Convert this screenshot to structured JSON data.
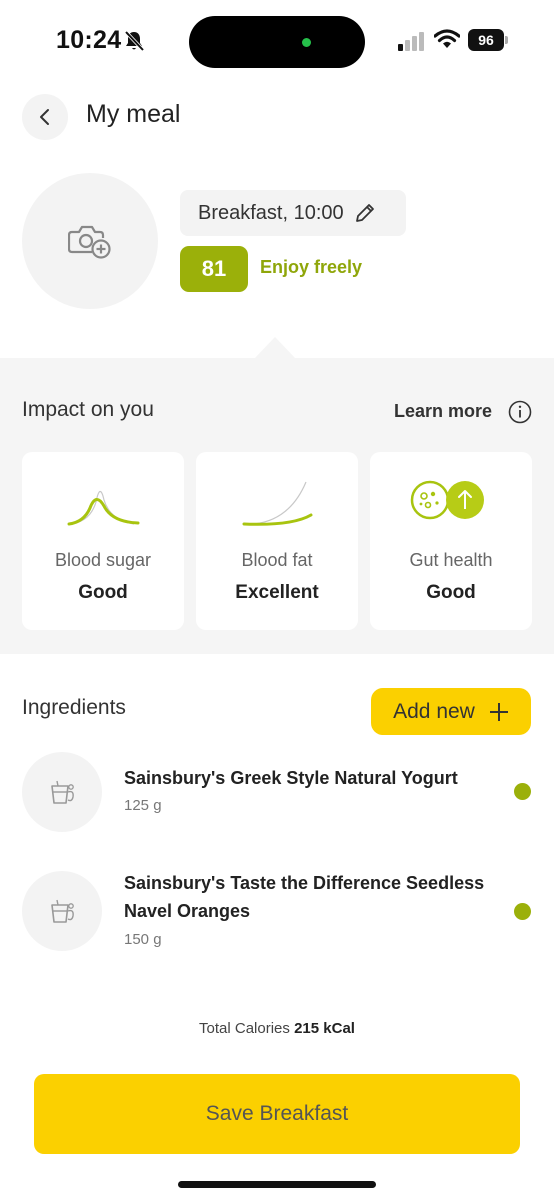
{
  "status_bar": {
    "time": "10:24",
    "battery": "96"
  },
  "header": {
    "title": "My meal"
  },
  "meal": {
    "label": "Breakfast, 10:00",
    "score": "81",
    "score_text": "Enjoy freely",
    "accent_color": "#9bb00a"
  },
  "impact": {
    "title": "Impact on you",
    "learn_more": "Learn more",
    "cards": [
      {
        "label": "Blood sugar",
        "value": "Good",
        "icon": "blood-sugar-curve-icon"
      },
      {
        "label": "Blood fat",
        "value": "Excellent",
        "icon": "blood-fat-curve-icon"
      },
      {
        "label": "Gut health",
        "value": "Good",
        "icon": "gut-health-icon"
      }
    ]
  },
  "ingredients": {
    "title": "Ingredients",
    "add_label": "Add new",
    "items": [
      {
        "name": "Sainsbury's Greek Style Natural Yogurt",
        "weight": "125 g",
        "status_color": "#9bb00a"
      },
      {
        "name": "Sainsbury's Taste the Difference Seedless Navel Oranges",
        "weight": "150 g",
        "status_color": "#9bb00a"
      }
    ]
  },
  "totals": {
    "label": "Total Calories",
    "value": "215 kCal"
  },
  "save": {
    "label": "Save Breakfast",
    "color": "#fbd000"
  }
}
